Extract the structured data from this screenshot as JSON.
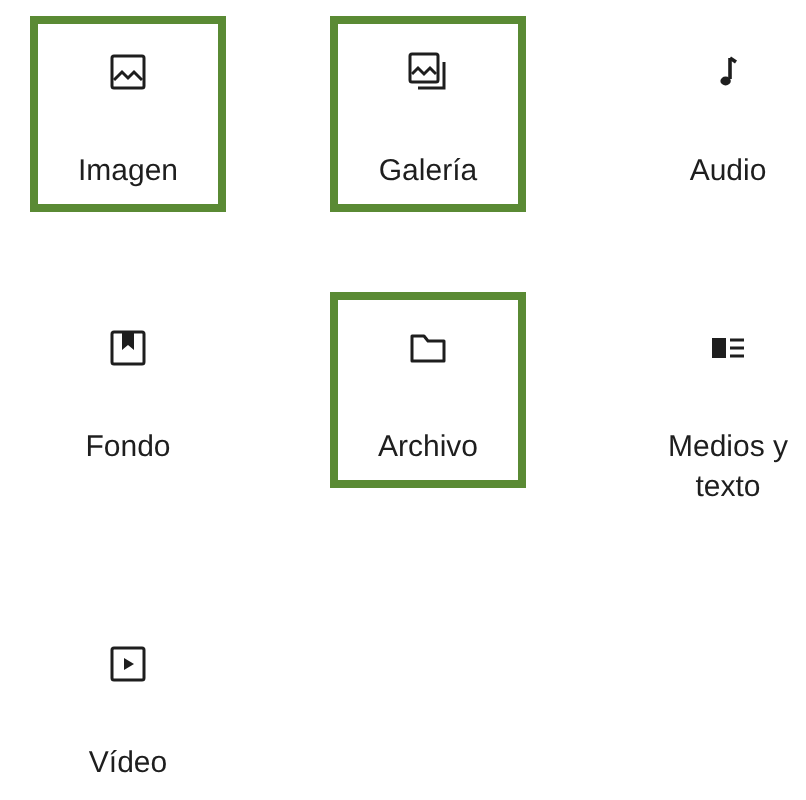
{
  "blocks": [
    {
      "kind": "image",
      "label": "Imagen",
      "highlighted": true
    },
    {
      "kind": "gallery",
      "label": "Galería",
      "highlighted": true
    },
    {
      "kind": "audio",
      "label": "Audio",
      "highlighted": false
    },
    {
      "kind": "cover",
      "label": "Fondo",
      "highlighted": false
    },
    {
      "kind": "file",
      "label": "Archivo",
      "highlighted": true
    },
    {
      "kind": "media-text",
      "label": "Medios y texto",
      "highlighted": false
    },
    {
      "kind": "video",
      "label": "Vídeo",
      "highlighted": false
    }
  ]
}
